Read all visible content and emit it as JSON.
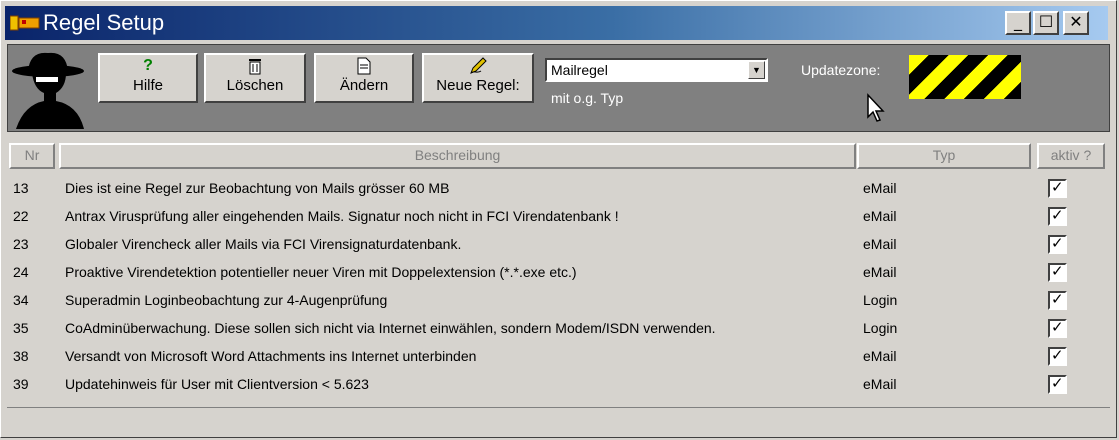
{
  "window": {
    "title": "Regel Setup",
    "controls": {
      "minimize": "_",
      "maximize": "☐",
      "close": "✕"
    }
  },
  "toolbar": {
    "buttons": [
      {
        "label": "Hilfe",
        "icon": "help-icon"
      },
      {
        "label": "Löschen",
        "icon": "trash-icon"
      },
      {
        "label": "Ändern",
        "icon": "document-icon"
      },
      {
        "label": "Neue Regel:",
        "icon": "pen-icon"
      }
    ],
    "rule_type": {
      "selected": "Mailregel",
      "note": "mit o.g. Typ"
    },
    "updatezone_label": "Updatezone:"
  },
  "table": {
    "columns": {
      "nr": "Nr",
      "beschreibung": "Beschreibung",
      "typ": "Typ",
      "aktiv": "aktiv ?"
    },
    "rows": [
      {
        "nr": "13",
        "beschreibung": "Dies ist eine Regel zur Beobachtung von Mails grösser 60 MB",
        "typ": "eMail",
        "aktiv": true
      },
      {
        "nr": "22",
        "beschreibung": "Antrax Virusprüfung aller eingehenden Mails. Signatur noch nicht in FCI Virendatenbank !",
        "typ": "eMail",
        "aktiv": true
      },
      {
        "nr": "23",
        "beschreibung": "Globaler Virencheck aller Mails via FCI Virensignaturdatenbank.",
        "typ": "eMail",
        "aktiv": true
      },
      {
        "nr": "24",
        "beschreibung": "Proaktive Virendetektion potentieller neuer Viren mit Doppelextension (*.*.exe etc.)",
        "typ": "eMail",
        "aktiv": true
      },
      {
        "nr": "34",
        "beschreibung": "Superadmin Loginbeobachtung zur 4-Augenprüfung",
        "typ": "Login",
        "aktiv": true
      },
      {
        "nr": "35",
        "beschreibung": "CoAdminüberwachung. Diese sollen sich nicht via Internet einwählen, sondern Modem/ISDN verwenden.",
        "typ": "Login",
        "aktiv": true
      },
      {
        "nr": "38",
        "beschreibung": "Versandt von Microsoft Word Attachments ins Internet unterbinden",
        "typ": "eMail",
        "aktiv": true
      },
      {
        "nr": "39",
        "beschreibung": "Updatehinweis für User mit Clientversion < 5.623",
        "typ": "eMail",
        "aktiv": true
      }
    ]
  },
  "colors": {
    "titlebar_start": "#0a246a",
    "titlebar_end": "#a6caf0",
    "toolbar": "#808080",
    "face": "#d6d3ce",
    "hazard_yellow": "#ffff00"
  }
}
